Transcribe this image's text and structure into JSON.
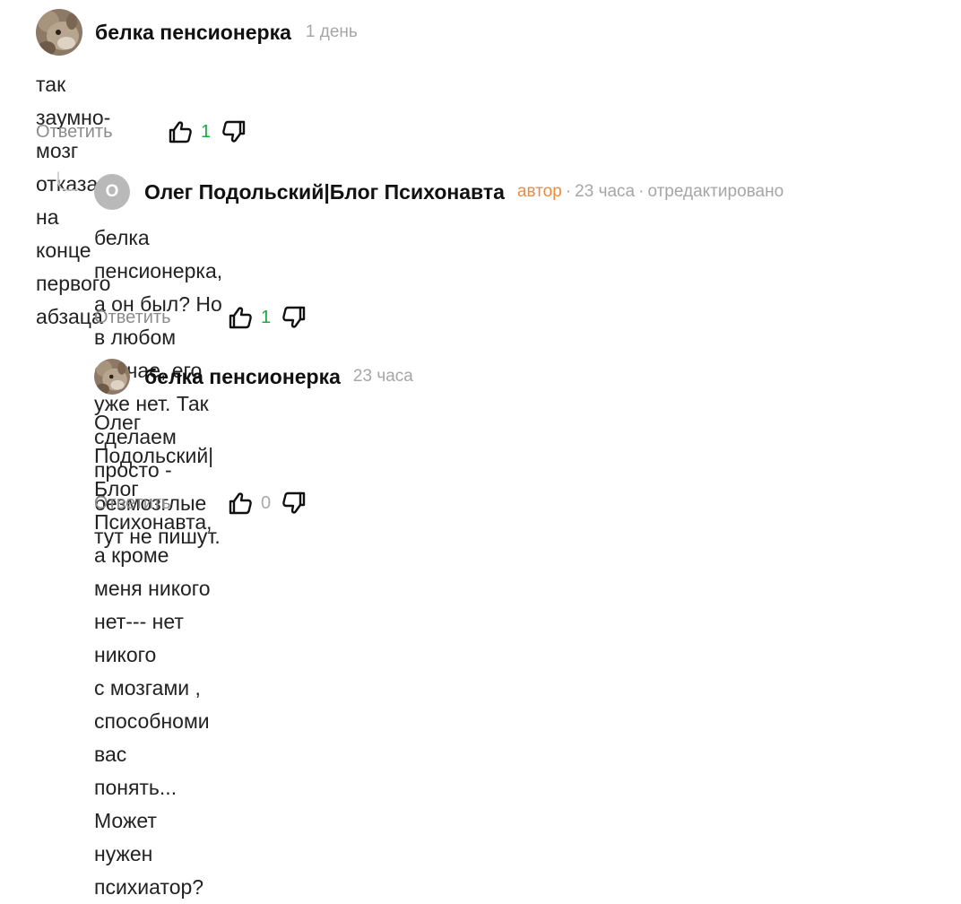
{
  "comments": [
    {
      "author": "белка пенсионерка",
      "time": "1 день",
      "text": "так заумно- мозг отказал на конце первого абзаца",
      "reply_label": "Ответить",
      "likes": "1"
    },
    {
      "avatar_letter": "О",
      "author": "Олег Подольский|Блог Психонавта",
      "badge": "автор",
      "time": "23 часа",
      "edited": "отредактировано",
      "text_lines": [
        "белка пенсионерка, а он был? Но в любом случае, его уже нет. Так сделаем",
        "просто - безмозглые тут не пишут."
      ],
      "reply_label": "Ответить",
      "likes": "1"
    },
    {
      "author": "белка пенсионерка",
      "time": "23 часа",
      "text_lines": [
        "Олег Подольский|Блог Психонавта, а кроме меня никого нет--- нет никого",
        "с мозгами , способноми вас понять... Может нужен психиатор?"
      ],
      "reply_label": "Ответить",
      "likes": "0"
    }
  ],
  "icons": {
    "like": "thumbs-up-icon",
    "dislike": "thumbs-down-icon",
    "thread": "reply-branch-icon"
  },
  "colors": {
    "like_count_positive": "#1aaa3b",
    "author_badge": "#f08a3b",
    "meta": "#a6a6a6"
  }
}
